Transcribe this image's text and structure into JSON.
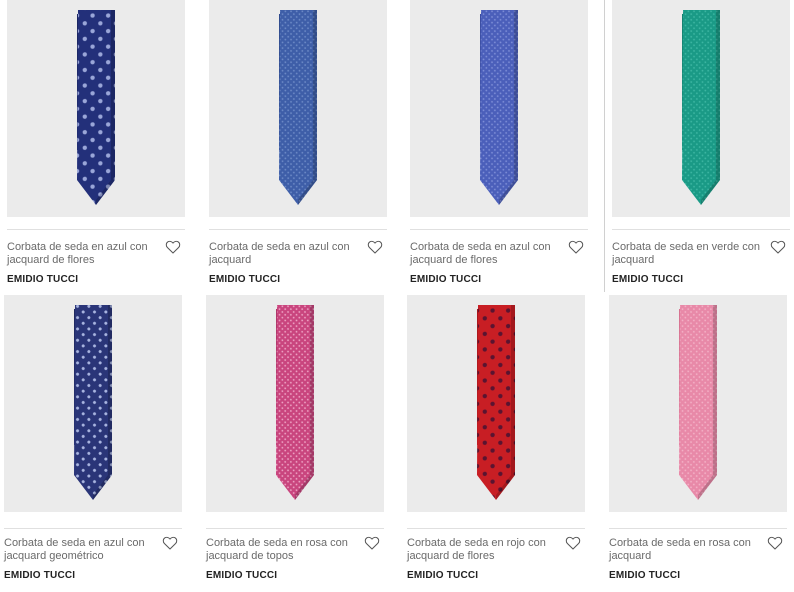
{
  "products": [
    {
      "title": "Corbata de seda en azul con jacquard de flores",
      "brand": "EMIDIO TUCCI",
      "tie": {
        "base": "#23307a",
        "dark": "#1a2460",
        "dot": "#9aa6d8",
        "pattern": "flower"
      }
    },
    {
      "title": "Corbata de seda en azul con jacquard",
      "brand": "EMIDIO TUCCI",
      "tie": {
        "base": "#3e5ea8",
        "dark": "#2f4a8c",
        "dot": "#6f8cc8",
        "pattern": "fine"
      }
    },
    {
      "title": "Corbata de seda en azul con jacquard de flores",
      "brand": "EMIDIO TUCCI",
      "tie": {
        "base": "#4b5fba",
        "dark": "#3a4ca0",
        "dot": "#8090d8",
        "pattern": "fine"
      }
    },
    {
      "title": "Corbata de seda en verde con jacquard",
      "brand": "EMIDIO TUCCI",
      "tie": {
        "base": "#1a9a86",
        "dark": "#14806f",
        "dot": "#3fb8a4",
        "pattern": "fine"
      }
    },
    {
      "title": "Corbata de seda en azul con jacquard geométrico",
      "brand": "EMIDIO TUCCI",
      "tie": {
        "base": "#2a3578",
        "dark": "#1f285f",
        "dot": "#a9b5e0",
        "pattern": "geo"
      }
    },
    {
      "title": "Corbata de seda en rosa con jacquard de topos",
      "brand": "EMIDIO TUCCI",
      "tie": {
        "base": "#c9457e",
        "dark": "#ad3568",
        "dot": "#f0a8c8",
        "pattern": "fine"
      }
    },
    {
      "title": "Corbata de seda en rojo con jacquard de flores",
      "brand": "EMIDIO TUCCI",
      "tie": {
        "base": "#c81e24",
        "dark": "#a8161b",
        "dot": "#5a1430",
        "pattern": "flower"
      }
    },
    {
      "title": "Corbata de seda en rosa con jacquard",
      "brand": "EMIDIO TUCCI",
      "tie": {
        "base": "#e889a8",
        "dark": "#d6718f",
        "dot": "#f4b3c8",
        "pattern": "fine"
      }
    }
  ],
  "icons": {
    "favorite": "heart-outline-icon"
  }
}
